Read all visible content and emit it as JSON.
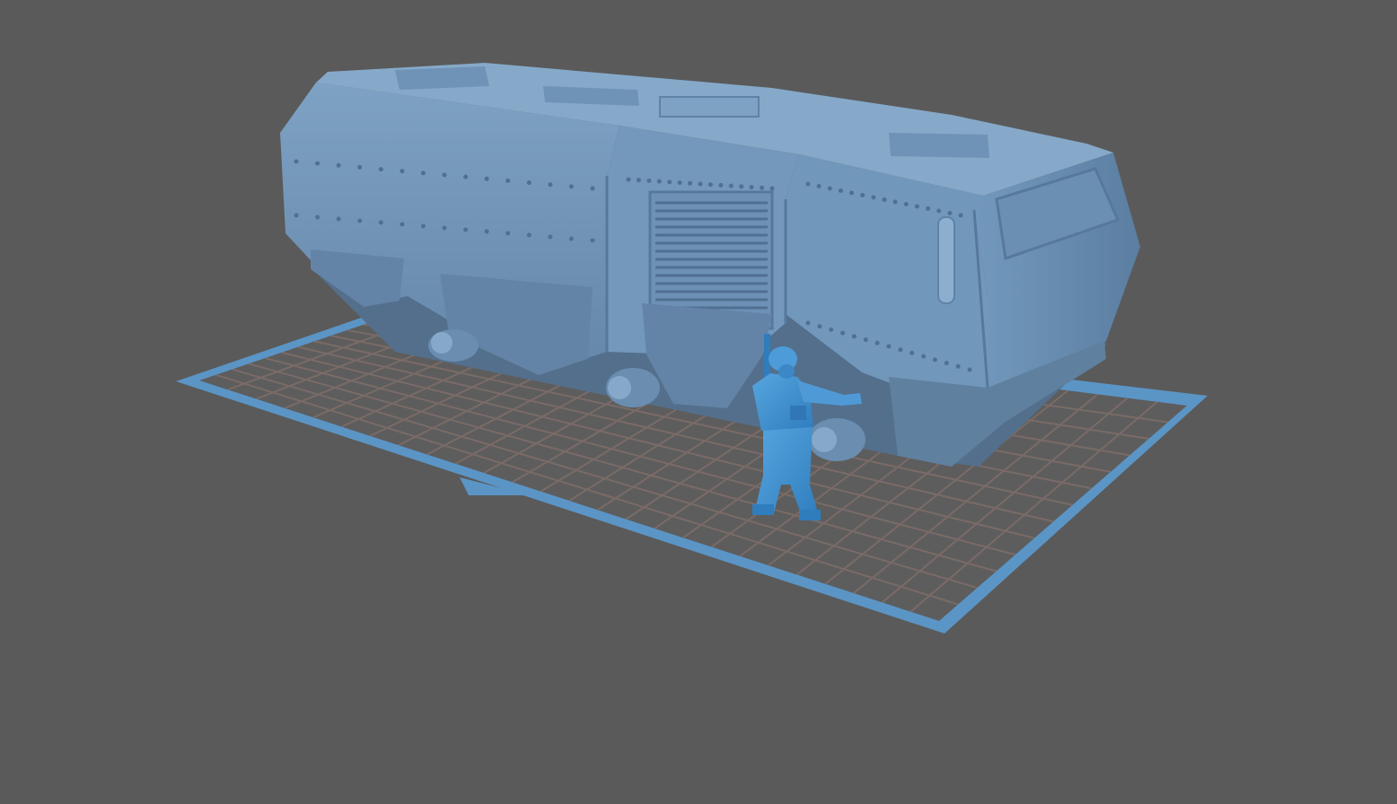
{
  "viewport": {
    "background_color": "#5a5a5a",
    "build_plate": {
      "grid_visible": true,
      "plate_color": "#5e5e5e",
      "grid_line_color": "#786a66",
      "border_color": "#5b95c6"
    },
    "models": [
      {
        "name": "armored-truck-model",
        "color": "#6f94b8",
        "selected": false
      },
      {
        "name": "soldier-figure-model",
        "color": "#3f8fcf",
        "selected": true
      }
    ]
  }
}
